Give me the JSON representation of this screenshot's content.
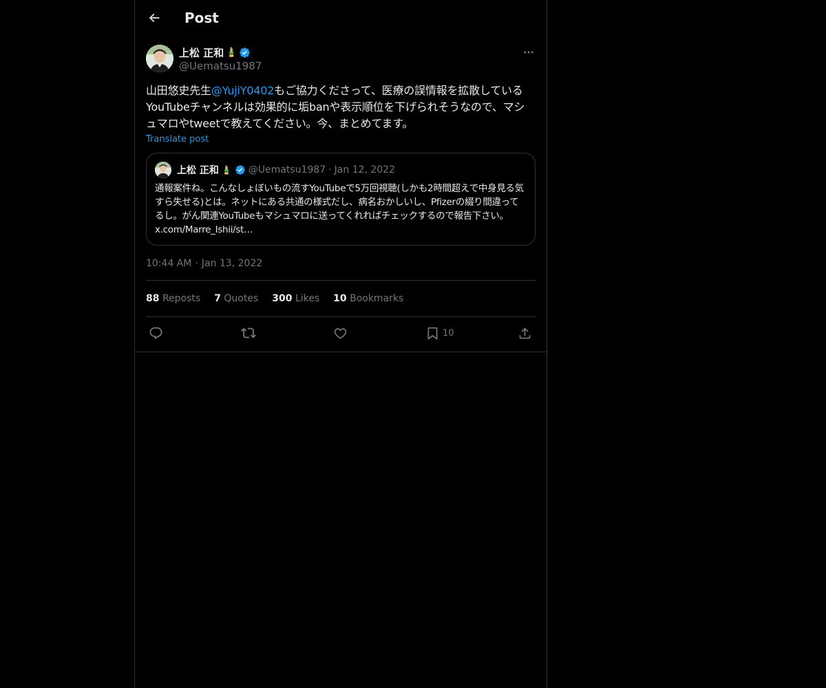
{
  "header": {
    "title": "Post"
  },
  "post": {
    "author_name": "上松 正和",
    "author_emoji": "🎍",
    "author_handle": "@Uematsu1987",
    "text_before": "山田悠史先生",
    "mention": "@YujiY0402",
    "text_after": "もご協力くださって、医療の誤情報を拡散しているYouTubeチャンネルは効果的に垢banや表示順位を下げられそうなので、マシュマロやtweetで教えてください。今、まとめてます。",
    "translate_label": "Translate post",
    "time": "10:44 AM",
    "date": "Jan 13, 2022",
    "separator": "·"
  },
  "quote": {
    "author_name": "上松 正和",
    "author_emoji": "🎍",
    "author_handle": "@Uematsu1987",
    "separator": "·",
    "date": "Jan 12, 2022",
    "text": "通報案件ね。こんなしょぼいもの流すYouTubeで5万回視聴(しかも2時間超えで中身見る気すら失せる)とは。ネットにある共通の様式だし、病名おかしいし、Pfizerの綴り間違ってるし。がん関連YouTubeもマシュマロに送ってくれればチェックするので報告下さい。",
    "link": "x.com/Marre_Ishii/st…"
  },
  "stats": {
    "reposts_count": "88",
    "reposts_label": "Reposts",
    "quotes_count": "7",
    "quotes_label": "Quotes",
    "likes_count": "300",
    "likes_label": "Likes",
    "bookmarks_count": "10",
    "bookmarks_label": "Bookmarks"
  },
  "actions": {
    "bookmark_count": "10"
  },
  "colors": {
    "accent": "#1d9bf0",
    "verified": "#1d9bf0",
    "muted": "#71767b",
    "border": "#2f3336",
    "background": "#000000"
  },
  "icons": [
    "back-arrow-icon",
    "more-icon",
    "verified-icon",
    "reply-icon",
    "repost-icon",
    "like-icon",
    "bookmark-icon",
    "share-icon"
  ]
}
